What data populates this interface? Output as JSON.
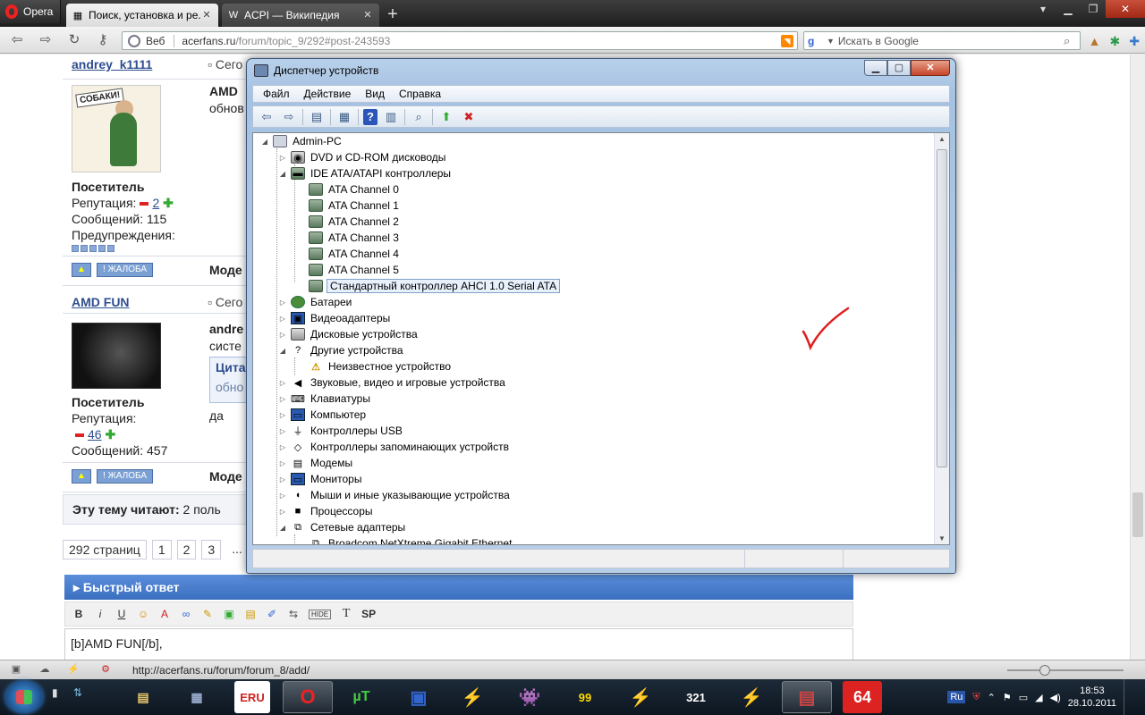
{
  "browser": {
    "app_name": "Opera",
    "tabs": [
      {
        "title": "Поиск, установка и ре...",
        "favicon": "page-icon",
        "active": true
      },
      {
        "title": "ACPI — Википедия",
        "favicon": "W",
        "active": false
      }
    ],
    "address": {
      "web_label": "Веб",
      "host": "acerfans.ru",
      "path": "/forum/topic_9/292#post-243593"
    },
    "search": {
      "placeholder": "Искать в Google"
    }
  },
  "forum": {
    "post1": {
      "username": "andrey_k1111",
      "today_label": "Сего",
      "avatar_text": "СОБАКИ!",
      "role": "Посетитель",
      "rep_label": "Репутация:",
      "rep_value": "2",
      "msgs": "Сообщений: 115",
      "warnings_label": "Предупреждения:",
      "text_title": "AMD",
      "text_body": "обнов",
      "moder": "Моде"
    },
    "post2": {
      "username": "AMD FUN",
      "today_label": "Сего",
      "role": "Посетитель",
      "rep_label": "Репутация:",
      "rep_value": "46",
      "msgs": "Сообщений: 457",
      "text_title": "andre",
      "text_body": "систе",
      "quote_label": "Цита",
      "quote_text": "обно",
      "reply": "да",
      "moder": "Моде"
    },
    "report_label": "ЖАЛОБА",
    "readers_bold": "Эту тему читают:",
    "readers_rest": "2 поль",
    "pages": [
      "292 страниц",
      "1",
      "2",
      "3",
      "..."
    ],
    "quick_reply_title": "Быстрый ответ",
    "editor_buttons": [
      "B",
      "i",
      "U",
      "☺",
      "A",
      "∞",
      "✎",
      "▣",
      "▤",
      "✐",
      "⇆",
      "HIDE",
      "T",
      "SP"
    ],
    "editor_text": "[b]AMD FUN[/b],"
  },
  "statusbar": {
    "url": "http://acerfans.ru/forum/forum_8/add/"
  },
  "taskbar": {
    "apps": [
      "explorer",
      "remote",
      "ERU",
      "O",
      "µT",
      "save",
      "⚡",
      "game",
      "99",
      "⚡",
      "321",
      "⚡",
      "",
      "64"
    ],
    "lang": "Ru",
    "time": "18:53",
    "date": "28.10.2011"
  },
  "device_manager": {
    "title": "Диспетчер устройств",
    "menu": [
      "Файл",
      "Действие",
      "Вид",
      "Справка"
    ],
    "root": "Admin-PC",
    "nodes": [
      {
        "label": "DVD и CD-ROM дисководы",
        "level": 1,
        "exp": "▷",
        "icon": "dvd-icon"
      },
      {
        "label": "IDE ATA/ATAPI контроллеры",
        "level": 1,
        "exp": "◢",
        "icon": "ide-controller-icon"
      },
      {
        "label": "ATA Channel 0",
        "level": 2,
        "exp": "",
        "icon": "ata-channel-icon"
      },
      {
        "label": "ATA Channel 1",
        "level": 2,
        "exp": "",
        "icon": "ata-channel-icon"
      },
      {
        "label": "ATA Channel 2",
        "level": 2,
        "exp": "",
        "icon": "ata-channel-icon"
      },
      {
        "label": "ATA Channel 3",
        "level": 2,
        "exp": "",
        "icon": "ata-channel-icon"
      },
      {
        "label": "ATA Channel 4",
        "level": 2,
        "exp": "",
        "icon": "ata-channel-icon"
      },
      {
        "label": "ATA Channel 5",
        "level": 2,
        "exp": "",
        "icon": "ata-channel-icon"
      },
      {
        "label": "Стандартный контроллер AHCI 1.0 Serial ATA",
        "level": 2,
        "exp": "",
        "icon": "ahci-controller-icon",
        "selected": true
      },
      {
        "label": "Батареи",
        "level": 1,
        "exp": "▷",
        "icon": "battery-icon"
      },
      {
        "label": "Видеоадаптеры",
        "level": 1,
        "exp": "▷",
        "icon": "display-adapter-icon"
      },
      {
        "label": "Дисковые устройства",
        "level": 1,
        "exp": "▷",
        "icon": "disk-drive-icon"
      },
      {
        "label": "Другие устройства",
        "level": 1,
        "exp": "◢",
        "icon": "other-devices-icon"
      },
      {
        "label": "Неизвестное устройство",
        "level": 2,
        "exp": "",
        "icon": "unknown-device-warning-icon"
      },
      {
        "label": "Звуковые, видео и игровые устройства",
        "level": 1,
        "exp": "▷",
        "icon": "sound-icon"
      },
      {
        "label": "Клавиатуры",
        "level": 1,
        "exp": "▷",
        "icon": "keyboard-icon"
      },
      {
        "label": "Компьютер",
        "level": 1,
        "exp": "▷",
        "icon": "computer-icon"
      },
      {
        "label": "Контроллеры USB",
        "level": 1,
        "exp": "▷",
        "icon": "usb-icon"
      },
      {
        "label": "Контроллеры запоминающих устройств",
        "level": 1,
        "exp": "▷",
        "icon": "storage-controller-icon"
      },
      {
        "label": "Модемы",
        "level": 1,
        "exp": "▷",
        "icon": "modem-icon"
      },
      {
        "label": "Мониторы",
        "level": 1,
        "exp": "▷",
        "icon": "monitor-icon"
      },
      {
        "label": "Мыши и иные указывающие устройства",
        "level": 1,
        "exp": "▷",
        "icon": "mouse-icon"
      },
      {
        "label": "Процессоры",
        "level": 1,
        "exp": "▷",
        "icon": "processor-icon"
      },
      {
        "label": "Сетевые адаптеры",
        "level": 1,
        "exp": "◢",
        "icon": "network-adapter-icon"
      },
      {
        "label": "Broadcom NetXtreme Gigabit Ethernet",
        "level": 2,
        "exp": "",
        "icon": "network-card-icon"
      }
    ]
  }
}
